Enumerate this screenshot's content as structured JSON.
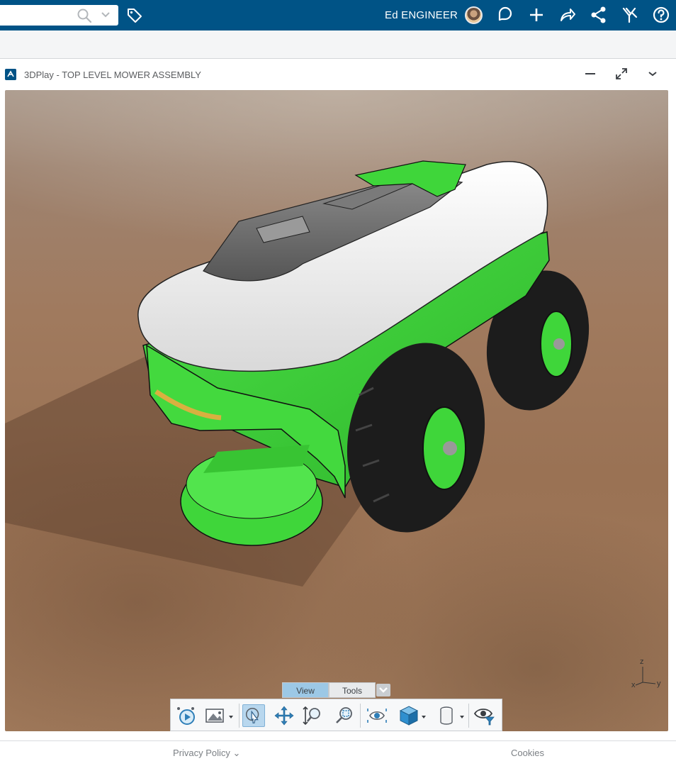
{
  "topbar": {
    "search_placeholder": "",
    "user_name": "Ed ENGINEER",
    "icons": [
      "search-icon",
      "chevron-down-icon",
      "tag-icon",
      "avatar",
      "feedback-icon",
      "plus-icon",
      "share-icon",
      "network-icon",
      "compass-icon",
      "help-icon"
    ]
  },
  "widget": {
    "title": "3DPlay - TOP LEVEL MOWER ASSEMBLY",
    "controls": [
      "minimize-icon",
      "maximize-icon",
      "chevron-down-icon"
    ]
  },
  "viewport": {
    "model": "mower-assembly",
    "colors": {
      "body_green": "#3fd63a",
      "shell_white": "#ececec",
      "cover_grey": "#6f6f6f",
      "tire_black": "#1c1c1c",
      "ground": "#a07a5e"
    },
    "axes": {
      "z": "z",
      "x": "x",
      "y": "y"
    }
  },
  "tabs": [
    {
      "label": "View",
      "active": true
    },
    {
      "label": "Tools",
      "active": false
    }
  ],
  "toolbar": {
    "tools": [
      "play-icon",
      "ambiance-icon",
      "select-icon",
      "pan-icon",
      "zoom-icon",
      "zoom-fit-icon",
      "view-orbit-icon",
      "view-cube-icon",
      "cylinder-icon",
      "visibility-icon"
    ]
  },
  "footer": {
    "privacy": "Privacy Policy",
    "cookies": "Cookies"
  }
}
